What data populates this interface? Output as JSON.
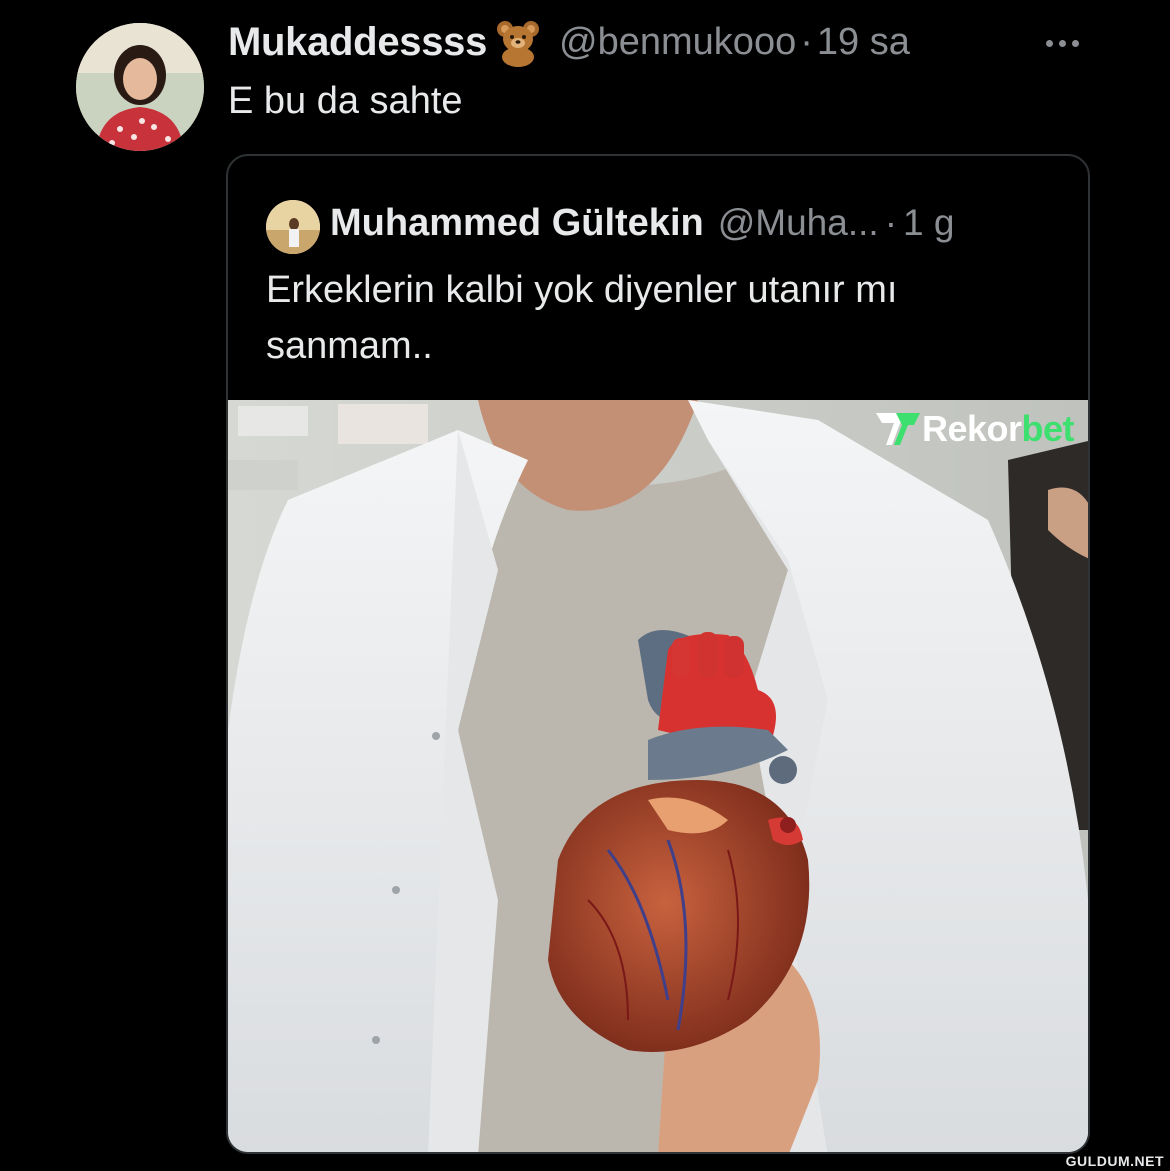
{
  "tweet": {
    "display_name": "Mukaddessss",
    "emoji": "teddy-bear-emoji",
    "handle": "@benmukooo",
    "separator": "·",
    "time": "19 sa",
    "text": "E bu da sahte"
  },
  "quoted_tweet": {
    "display_name": "Muhammed Gültekin",
    "handle": "@Muha...",
    "separator": "·",
    "time": "1 g",
    "text": "Erkeklerin kalbi yok diyenler utanır mı\nsanmam..",
    "media_watermark": {
      "text": "Rekor",
      "accent": "bet"
    }
  },
  "site_watermark": "GULDUM.NET",
  "colors": {
    "background": "#000000",
    "text_primary": "#e7e9ea",
    "text_secondary": "#8b8f94",
    "border": "#2f3336",
    "brand_accent": "#3de06f"
  }
}
